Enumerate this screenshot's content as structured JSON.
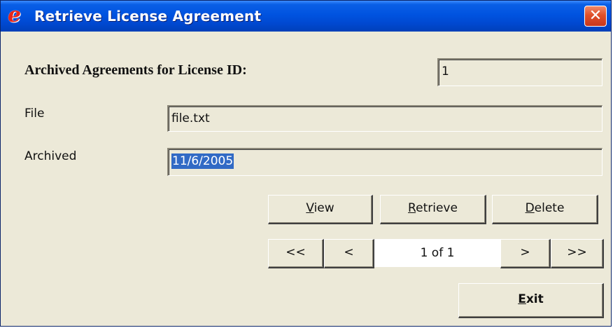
{
  "window": {
    "title": "Retrieve License Agreement",
    "app_icon_glyph": "e",
    "close_glyph": "✕"
  },
  "license": {
    "label": "Archived Agreements for License ID:",
    "value": "1"
  },
  "file": {
    "label": "File",
    "value": "file.txt"
  },
  "archived": {
    "label": "Archived",
    "value": "11/6/2005"
  },
  "actions": {
    "view": {
      "mnemonic": "V",
      "rest": "iew"
    },
    "retrieve": {
      "mnemonic": "R",
      "rest": "etrieve"
    },
    "delete": {
      "mnemonic": "D",
      "rest": "elete"
    }
  },
  "nav": {
    "first": "<<",
    "prev": "<",
    "position": "1 of 1",
    "next": ">",
    "last": ">>"
  },
  "exit": {
    "mnemonic": "E",
    "rest": "xit"
  },
  "colors": {
    "titlebar": "#0053e0",
    "window_bg": "#ece9d8",
    "selection": "#316ac5",
    "close_button": "#e0502a"
  },
  "icons": [
    "app-e-icon",
    "close-icon"
  ]
}
